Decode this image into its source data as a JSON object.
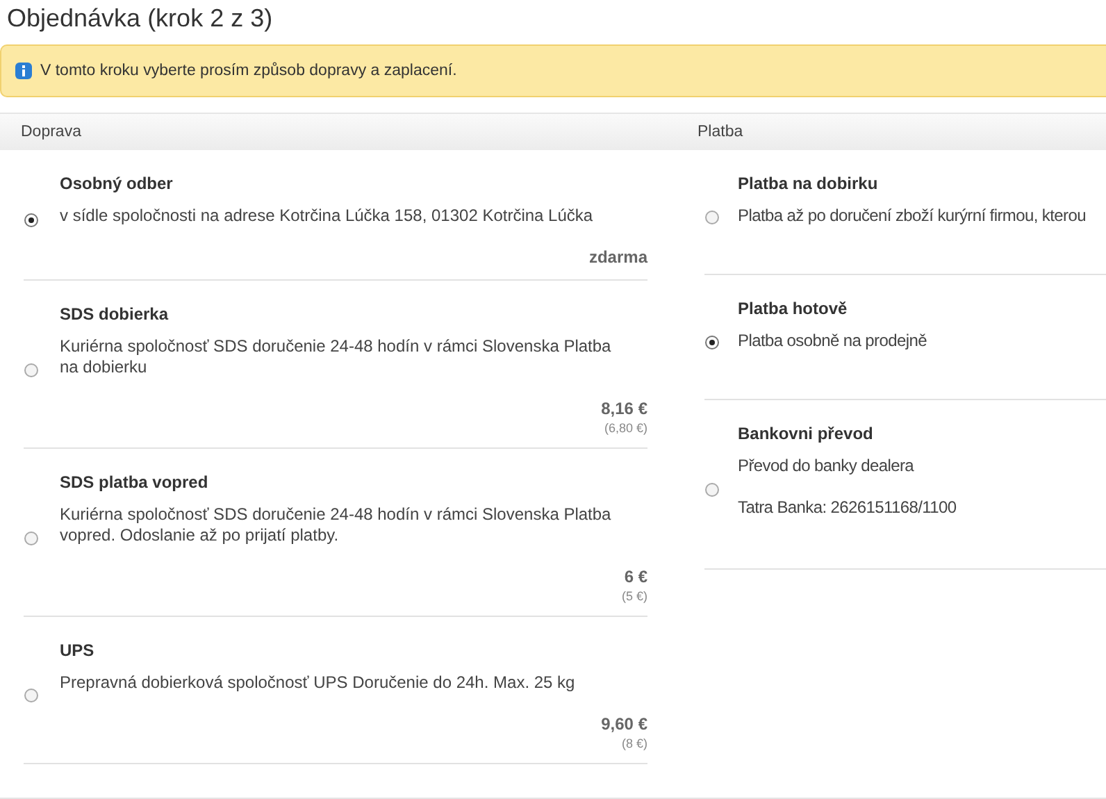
{
  "title": "Objednávka (krok 2 z 3)",
  "notice": "V tomto kroku vyberte prosím způsob dopravy a zaplacení.",
  "shipping": {
    "heading": "Doprava",
    "options": [
      {
        "name": "Osobný odber",
        "description": "v sídle spoločnosti na adrese Kotrčina Lúčka 158, 01302 Kotrčina Lúčka",
        "price": "zdarma",
        "selected": true
      },
      {
        "name": "SDS dobierka",
        "description": "Kuriérna spoločnosť SDS doručenie 24-48 hodín v rámci Slovenska Platba na dobierku",
        "price": "8,16 €",
        "price_net": "(6,80 €)",
        "selected": false
      },
      {
        "name": "SDS platba vopred",
        "description": "Kuriérna spoločnosť SDS doručenie 24-48 hodín v rámci Slovenska Platba vopred. Odoslanie až po prijatí platby.",
        "price": "6 €",
        "price_net": "(5 €)",
        "selected": false
      },
      {
        "name": "UPS",
        "description": "Prepravná dobierková spoločnosť UPS Doručenie do 24h. Max. 25 kg",
        "price": "9,60 €",
        "price_net": "(8 €)",
        "selected": false
      }
    ]
  },
  "payment": {
    "heading": "Platba",
    "options": [
      {
        "name": "Platba na dobirku",
        "lines": [
          "Platba až po doručení zboží kurýrní firmou, kterou"
        ],
        "selected": false
      },
      {
        "name": "Platba hotově",
        "lines": [
          "Platba osobně na prodejně"
        ],
        "selected": true
      },
      {
        "name": "Bankovni převod",
        "lines": [
          "Převod do banky dealera",
          "Tatra Banka: 2626151168/1100"
        ],
        "selected": false
      }
    ]
  }
}
